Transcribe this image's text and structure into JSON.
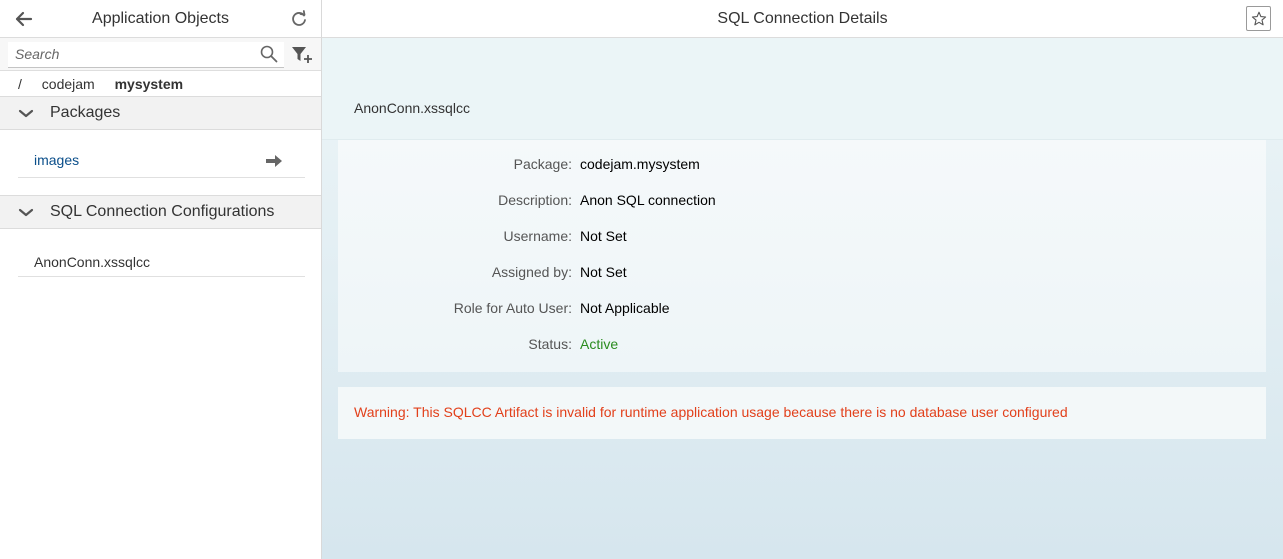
{
  "master": {
    "title": "Application Objects",
    "search": {
      "placeholder": "Search",
      "value": ""
    },
    "breadcrumb": {
      "root": "/",
      "parent": "codejam",
      "current": "mysystem"
    },
    "groups": [
      {
        "label": "Packages",
        "items": [
          {
            "label": "images"
          }
        ]
      },
      {
        "label": "SQL Connection Configurations",
        "items": [
          {
            "label": "AnonConn.xssqlcc"
          }
        ]
      }
    ]
  },
  "detail": {
    "title": "SQL Connection Details",
    "object_title": "AnonConn.xssqlcc",
    "fields": {
      "package": {
        "label": "Package:",
        "value": "codejam.mysystem"
      },
      "description": {
        "label": "Description:",
        "value": "Anon SQL connection"
      },
      "username": {
        "label": "Username:",
        "value": "Not Set"
      },
      "assigned_by": {
        "label": "Assigned by:",
        "value": "Not Set"
      },
      "role": {
        "label": "Role for Auto User:",
        "value": "Not Applicable"
      },
      "status": {
        "label": "Status:",
        "value": "Active"
      }
    },
    "warning": "Warning: This SQLCC Artifact is invalid for runtime application usage because there is no database user configured"
  },
  "icons": {
    "back": "back-arrow-icon",
    "refresh": "refresh-icon",
    "search": "search-icon",
    "filter": "filter-add-icon",
    "collapse": "chevron-down-icon",
    "navigate": "right-arrow-icon",
    "favorite": "star-icon"
  },
  "colors": {
    "link": "#0a4e8a",
    "status_active": "#2b8c1f",
    "warning": "#e2401b"
  }
}
